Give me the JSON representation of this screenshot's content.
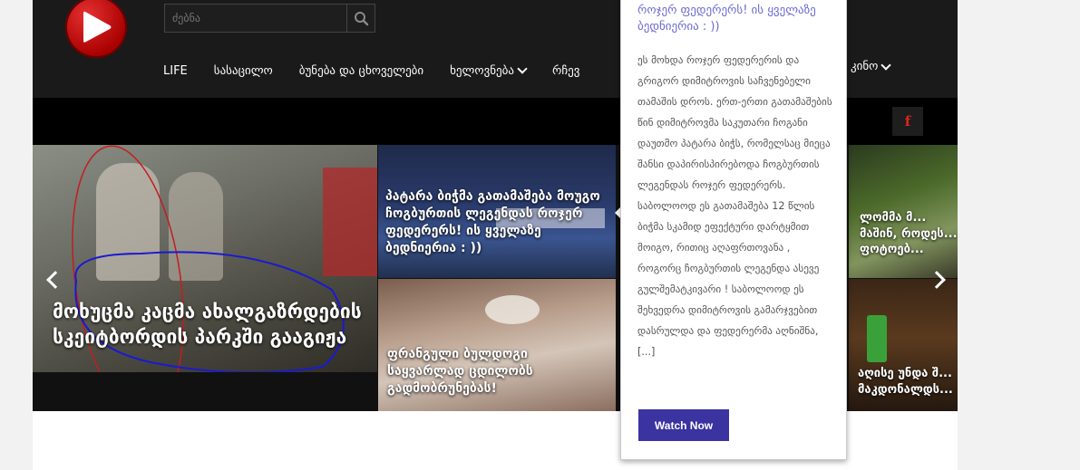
{
  "header": {
    "search": {
      "placeholder": "ძებნა"
    },
    "nav": {
      "items": [
        {
          "label": "LIFE",
          "dropdown": false
        },
        {
          "label": "სასაცილო",
          "dropdown": false
        },
        {
          "label": "ბუნება და ცხოველები",
          "dropdown": false
        },
        {
          "label": "ხელოვნება",
          "dropdown": true
        },
        {
          "label": "რჩევ",
          "dropdown": false
        }
      ],
      "kino": {
        "label": "კინო",
        "dropdown": true
      }
    },
    "social": {
      "facebook_glyph": "f"
    }
  },
  "slider": {
    "slides": [
      {
        "caption": "მოხუცმა კაცმა ახალგაზრდების სკეიტბორდის პარკში გააგიჟა"
      },
      {
        "caption": "პატარა ბიჭმა გათამაშება მოუგო ჩოგბურთის ლეგენდას როჯერ ფედერერს! ის ყველაზე ბედნიერია : ))"
      },
      {
        "caption": "ფრანგული ბულდოგი საყვარლად ცდილობს გადმობრუნებას!"
      },
      {
        "caption": "ლომმა მ... მაშინ, როდეს... ფოტოებ..."
      },
      {
        "caption": "აღისე უნდა შ... მაკდონალდს..."
      }
    ]
  },
  "popup": {
    "title": "როჯერ ფედერერს! ის ყველაზე ბედნიერია : ))",
    "body": "ეს მოხდა როჯერ ფედერერის და გრიგორ დიმიტროვის საჩვენებელი თამაშის დროს. ერთ-ერთი გათამაშების წინ დიმიტროვმა საკუთარი ჩოგანი დაუთმო პატარა ბიჭს, რომელსაც მიეცა შანსი დაპირისპირებოდა ჩოგბურთის ლეგენდას როჯერ ფედერერს. საბოლოოდ ეს გათამაშება 12 წლის ბიჭმა სკამიდ ეფექტური დარტყმით მოიგო, რითიც აღაფრთოვანა , როგორც ჩოგბურთის ლეგენდა ასევე გულშემატკივარი ! საბოლოოდ ეს შეხვედრა დიმიტროვის გამარჯვებით დასრულდა და ფედერერმა აღნიშნა, [...]",
    "button_label": "Watch Now"
  },
  "colors": {
    "header_bg": "#1a1a1a",
    "accent_red": "#d40000",
    "popup_title": "#6a6ad0",
    "button_bg": "#3a33a0"
  }
}
